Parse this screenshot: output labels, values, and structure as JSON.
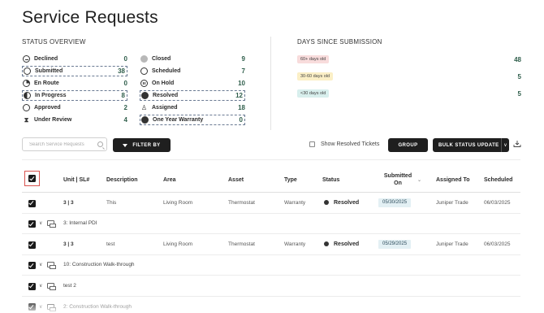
{
  "page": {
    "title": "Service Requests"
  },
  "status_overview": {
    "label": "STATUS OVERVIEW",
    "left": [
      {
        "label": "Declined",
        "count": "0",
        "icon": "declined-icon",
        "boxed": false
      },
      {
        "label": "Submitted",
        "count": "38",
        "icon": "submitted-icon",
        "boxed": true
      },
      {
        "label": "En Route",
        "count": "0",
        "icon": "en-route-icon",
        "boxed": false
      },
      {
        "label": "In Progress",
        "count": "8",
        "icon": "in-progress-icon",
        "boxed": true
      },
      {
        "label": "Approved",
        "count": "2",
        "icon": "approved-icon",
        "boxed": false
      },
      {
        "label": "Under Review",
        "count": "4",
        "icon": "hourglass-icon",
        "boxed": false
      }
    ],
    "right": [
      {
        "label": "Closed",
        "count": "9",
        "icon": "closed-icon",
        "boxed": false
      },
      {
        "label": "Scheduled",
        "count": "7",
        "icon": "scheduled-icon",
        "boxed": false
      },
      {
        "label": "On Hold",
        "count": "10",
        "icon": "on-hold-icon",
        "boxed": false
      },
      {
        "label": "Resolved",
        "count": "12",
        "icon": "resolved-icon",
        "boxed": true
      },
      {
        "label": "Assigned",
        "count": "18",
        "icon": "assigned-person-icon",
        "boxed": false
      },
      {
        "label": "One Year Warranty",
        "count": "0",
        "icon": "warranty-icon",
        "boxed": true
      }
    ]
  },
  "days_since": {
    "label": "DAYS SINCE SUBMISSION",
    "rows": [
      {
        "label": "60+ days old",
        "count": "48",
        "color": "#f8dcdc"
      },
      {
        "label": "30-60 days old",
        "count": "5",
        "color": "#fbefc6"
      },
      {
        "label": "<30 days old",
        "count": "5",
        "color": "#d8efed"
      }
    ]
  },
  "toolbar": {
    "search_placeholder": "Search Service Requests",
    "filter_label": "FILTER BY",
    "show_resolved_label": "Show Resolved Tickets",
    "group_label": "GROUP",
    "bulk_label": "BULK STATUS UPDATE",
    "bulk_caret": "∨"
  },
  "table": {
    "headers": {
      "unit": "Unit | SL#",
      "description": "Description",
      "area": "Area",
      "asset": "Asset",
      "type": "Type",
      "status": "Status",
      "submitted_line1": "Submitted",
      "submitted_line2": "On",
      "assigned_to": "Assigned To",
      "scheduled": "Scheduled"
    },
    "rows": [
      {
        "kind": "data",
        "unit": "3 | 3",
        "description": "This",
        "area": "Living Room",
        "asset": "Thermostat",
        "type": "Warranty",
        "status": "Resolved",
        "submitted": "05/30/2025",
        "assigned": "Juniper Trade",
        "scheduled": "06/03/2025"
      },
      {
        "kind": "group",
        "label": "3: Internal PDI"
      },
      {
        "kind": "data",
        "unit": "3 | 3",
        "description": "test",
        "area": "Living Room",
        "asset": "Thermostat",
        "type": "Warranty",
        "status": "Resolved",
        "submitted": "05/29/2025",
        "assigned": "Juniper Trade",
        "scheduled": "06/03/2025"
      },
      {
        "kind": "group",
        "label": "10: Construction Walk-through"
      },
      {
        "kind": "group",
        "label": "test 2"
      },
      {
        "kind": "group",
        "label": "2: Construction Walk-through"
      }
    ]
  }
}
